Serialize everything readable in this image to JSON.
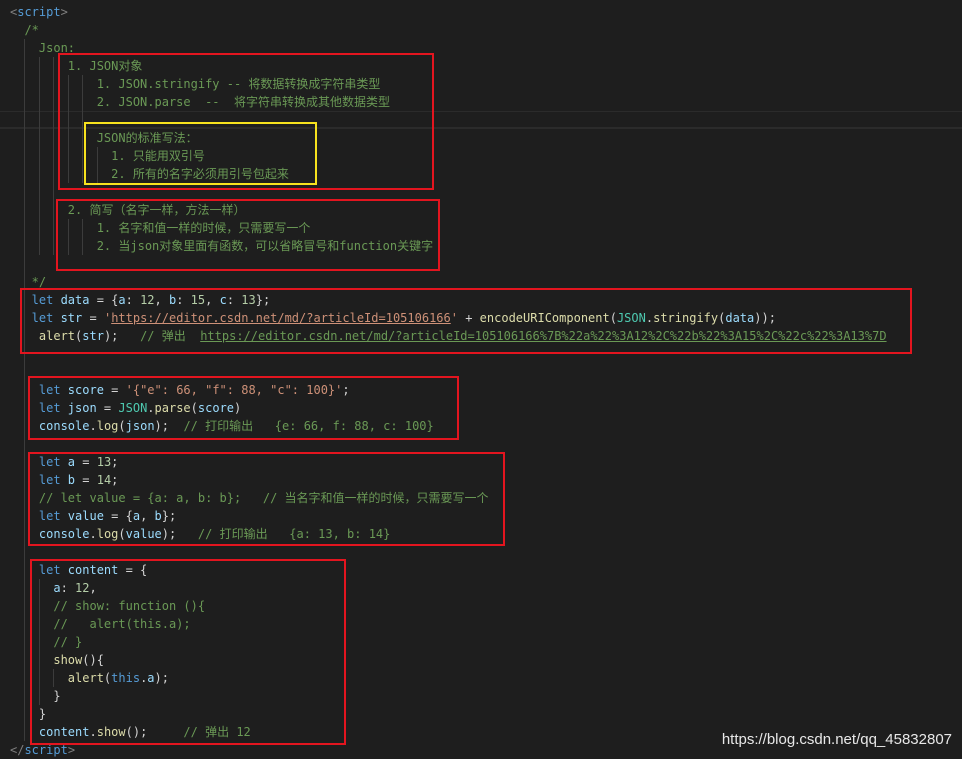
{
  "colors": {
    "background": "#1e1e1e",
    "annotation_red": "#e3151f",
    "annotation_yellow": "#f7e21e",
    "indent_guide": "#3c3c3c",
    "watermark": "#e8e8e8"
  },
  "editor": {
    "lines": [
      [
        [
          "<",
          "#808080"
        ],
        [
          "script",
          "#569cd6"
        ],
        [
          ">",
          "#808080"
        ]
      ],
      [
        [
          "  /*",
          "#6a9955"
        ]
      ],
      [
        [
          "    Json:",
          "#6a9955"
        ]
      ],
      [
        [
          "        1. JSON对象",
          "#6a9955"
        ]
      ],
      [
        [
          "            1. JSON.stringify -- 将数据转换成字符串类型",
          "#6a9955"
        ]
      ],
      [
        [
          "            2. JSON.parse  --  将字符串转换成其他数据类型",
          "#6a9955"
        ]
      ],
      [],
      [
        [
          "            JSON的标准写法：",
          "#6a9955"
        ]
      ],
      [
        [
          "              1. 只能用双引号",
          "#6a9955"
        ]
      ],
      [
        [
          "              2. 所有的名字必须用引号包起来",
          "#6a9955"
        ]
      ],
      [],
      [
        [
          "        2. 简写（名字一样，方法一样）",
          "#6a9955"
        ]
      ],
      [
        [
          "            1. 名字和值一样的时候，只需要写一个",
          "#6a9955"
        ]
      ],
      [
        [
          "            2. 当json对象里面有函数，可以省略冒号和function关键字",
          "#6a9955"
        ]
      ],
      [],
      [
        [
          "   */",
          "#6a9955"
        ]
      ],
      [
        [
          "   let",
          "#569cd6"
        ],
        [
          " data",
          "#9cdcfe"
        ],
        [
          " = {",
          "#d4d4d4"
        ],
        [
          "a",
          "#9cdcfe"
        ],
        [
          ": ",
          "#d4d4d4"
        ],
        [
          "12",
          "#b5cea8"
        ],
        [
          ", ",
          "#d4d4d4"
        ],
        [
          "b",
          "#9cdcfe"
        ],
        [
          ": ",
          "#d4d4d4"
        ],
        [
          "15",
          "#b5cea8"
        ],
        [
          ", ",
          "#d4d4d4"
        ],
        [
          "c",
          "#9cdcfe"
        ],
        [
          ": ",
          "#d4d4d4"
        ],
        [
          "13",
          "#b5cea8"
        ],
        [
          "};",
          "#d4d4d4"
        ]
      ],
      [
        [
          "   let",
          "#569cd6"
        ],
        [
          " str",
          "#9cdcfe"
        ],
        [
          " = ",
          "#d4d4d4"
        ],
        [
          "'",
          "#ce9178"
        ],
        [
          "https://editor.csdn.net/md/?articleId=105106166",
          "#ce9178",
          1
        ],
        [
          "'",
          "#ce9178"
        ],
        [
          " + ",
          "#d4d4d4"
        ],
        [
          "encodeURIComponent",
          "#dcdcaa"
        ],
        [
          "(",
          "#d4d4d4"
        ],
        [
          "JSON",
          "#4ec9b0"
        ],
        [
          ".",
          "#d4d4d4"
        ],
        [
          "stringify",
          "#dcdcaa"
        ],
        [
          "(",
          "#d4d4d4"
        ],
        [
          "data",
          "#9cdcfe"
        ],
        [
          "));",
          "#d4d4d4"
        ]
      ],
      [
        [
          "    alert",
          "#dcdcaa"
        ],
        [
          "(",
          "#d4d4d4"
        ],
        [
          "str",
          "#9cdcfe"
        ],
        [
          ");   ",
          "#d4d4d4"
        ],
        [
          "// 弹出  ",
          "#6a9955"
        ],
        [
          "https://editor.csdn.net/md/?articleId=105106166%7B%22a%22%3A12%2C%22b%22%3A15%2C%22c%22%3A13%7D",
          "#6a9955",
          1
        ]
      ],
      [],
      [],
      [
        [
          "    let",
          "#569cd6"
        ],
        [
          " score",
          "#9cdcfe"
        ],
        [
          " = ",
          "#d4d4d4"
        ],
        [
          "'{\"e\": 66, \"f\": 88, \"c\": 100}'",
          "#ce9178"
        ],
        [
          ";",
          "#d4d4d4"
        ]
      ],
      [
        [
          "    let",
          "#569cd6"
        ],
        [
          " json",
          "#9cdcfe"
        ],
        [
          " = ",
          "#d4d4d4"
        ],
        [
          "JSON",
          "#4ec9b0"
        ],
        [
          ".",
          "#d4d4d4"
        ],
        [
          "parse",
          "#dcdcaa"
        ],
        [
          "(",
          "#d4d4d4"
        ],
        [
          "score",
          "#9cdcfe"
        ],
        [
          ")",
          "#d4d4d4"
        ]
      ],
      [
        [
          "    console",
          "#9cdcfe"
        ],
        [
          ".",
          "#d4d4d4"
        ],
        [
          "log",
          "#dcdcaa"
        ],
        [
          "(",
          "#d4d4d4"
        ],
        [
          "json",
          "#9cdcfe"
        ],
        [
          ");  ",
          "#d4d4d4"
        ],
        [
          "// 打印输出   {e: 66, f: 88, c: 100}",
          "#6a9955"
        ]
      ],
      [],
      [
        [
          "    let",
          "#569cd6"
        ],
        [
          " a",
          "#9cdcfe"
        ],
        [
          " = ",
          "#d4d4d4"
        ],
        [
          "13",
          "#b5cea8"
        ],
        [
          ";",
          "#d4d4d4"
        ]
      ],
      [
        [
          "    let",
          "#569cd6"
        ],
        [
          " b",
          "#9cdcfe"
        ],
        [
          " = ",
          "#d4d4d4"
        ],
        [
          "14",
          "#b5cea8"
        ],
        [
          ";",
          "#d4d4d4"
        ]
      ],
      [
        [
          "    // let value = {a: a, b: b};   // 当名字和值一样的时候，只需要写一个",
          "#6a9955"
        ]
      ],
      [
        [
          "    let",
          "#569cd6"
        ],
        [
          " value",
          "#9cdcfe"
        ],
        [
          " = {",
          "#d4d4d4"
        ],
        [
          "a",
          "#9cdcfe"
        ],
        [
          ", ",
          "#d4d4d4"
        ],
        [
          "b",
          "#9cdcfe"
        ],
        [
          "};",
          "#d4d4d4"
        ]
      ],
      [
        [
          "    console",
          "#9cdcfe"
        ],
        [
          ".",
          "#d4d4d4"
        ],
        [
          "log",
          "#dcdcaa"
        ],
        [
          "(",
          "#d4d4d4"
        ],
        [
          "value",
          "#9cdcfe"
        ],
        [
          ");   ",
          "#d4d4d4"
        ],
        [
          "// 打印输出   {a: 13, b: 14}",
          "#6a9955"
        ]
      ],
      [],
      [
        [
          "    let",
          "#569cd6"
        ],
        [
          " content",
          "#9cdcfe"
        ],
        [
          " = {",
          "#d4d4d4"
        ]
      ],
      [
        [
          "      a",
          "#9cdcfe"
        ],
        [
          ": ",
          "#d4d4d4"
        ],
        [
          "12",
          "#b5cea8"
        ],
        [
          ",",
          "#d4d4d4"
        ]
      ],
      [
        [
          "      // show: function (){",
          "#6a9955"
        ]
      ],
      [
        [
          "      //   alert(this.a);",
          "#6a9955"
        ]
      ],
      [
        [
          "      // }",
          "#6a9955"
        ]
      ],
      [
        [
          "      show",
          "#dcdcaa"
        ],
        [
          "(){",
          "#d4d4d4"
        ]
      ],
      [
        [
          "        alert",
          "#dcdcaa"
        ],
        [
          "(",
          "#d4d4d4"
        ],
        [
          "this",
          "#569cd6"
        ],
        [
          ".",
          "#d4d4d4"
        ],
        [
          "a",
          "#9cdcfe"
        ],
        [
          ");",
          "#d4d4d4"
        ]
      ],
      [
        [
          "      }",
          "#d4d4d4"
        ]
      ],
      [
        [
          "    }",
          "#d4d4d4"
        ]
      ],
      [
        [
          "    content",
          "#9cdcfe"
        ],
        [
          ".",
          "#d4d4d4"
        ],
        [
          "show",
          "#dcdcaa"
        ],
        [
          "();     ",
          "#d4d4d4"
        ],
        [
          "// 弹出 12",
          "#6a9955"
        ]
      ],
      [
        [
          "</",
          "#808080"
        ],
        [
          "script",
          "#569cd6"
        ],
        [
          ">",
          "#808080"
        ]
      ]
    ]
  },
  "watermark": {
    "text": "https://blog.csdn.net/qq_45832807"
  }
}
